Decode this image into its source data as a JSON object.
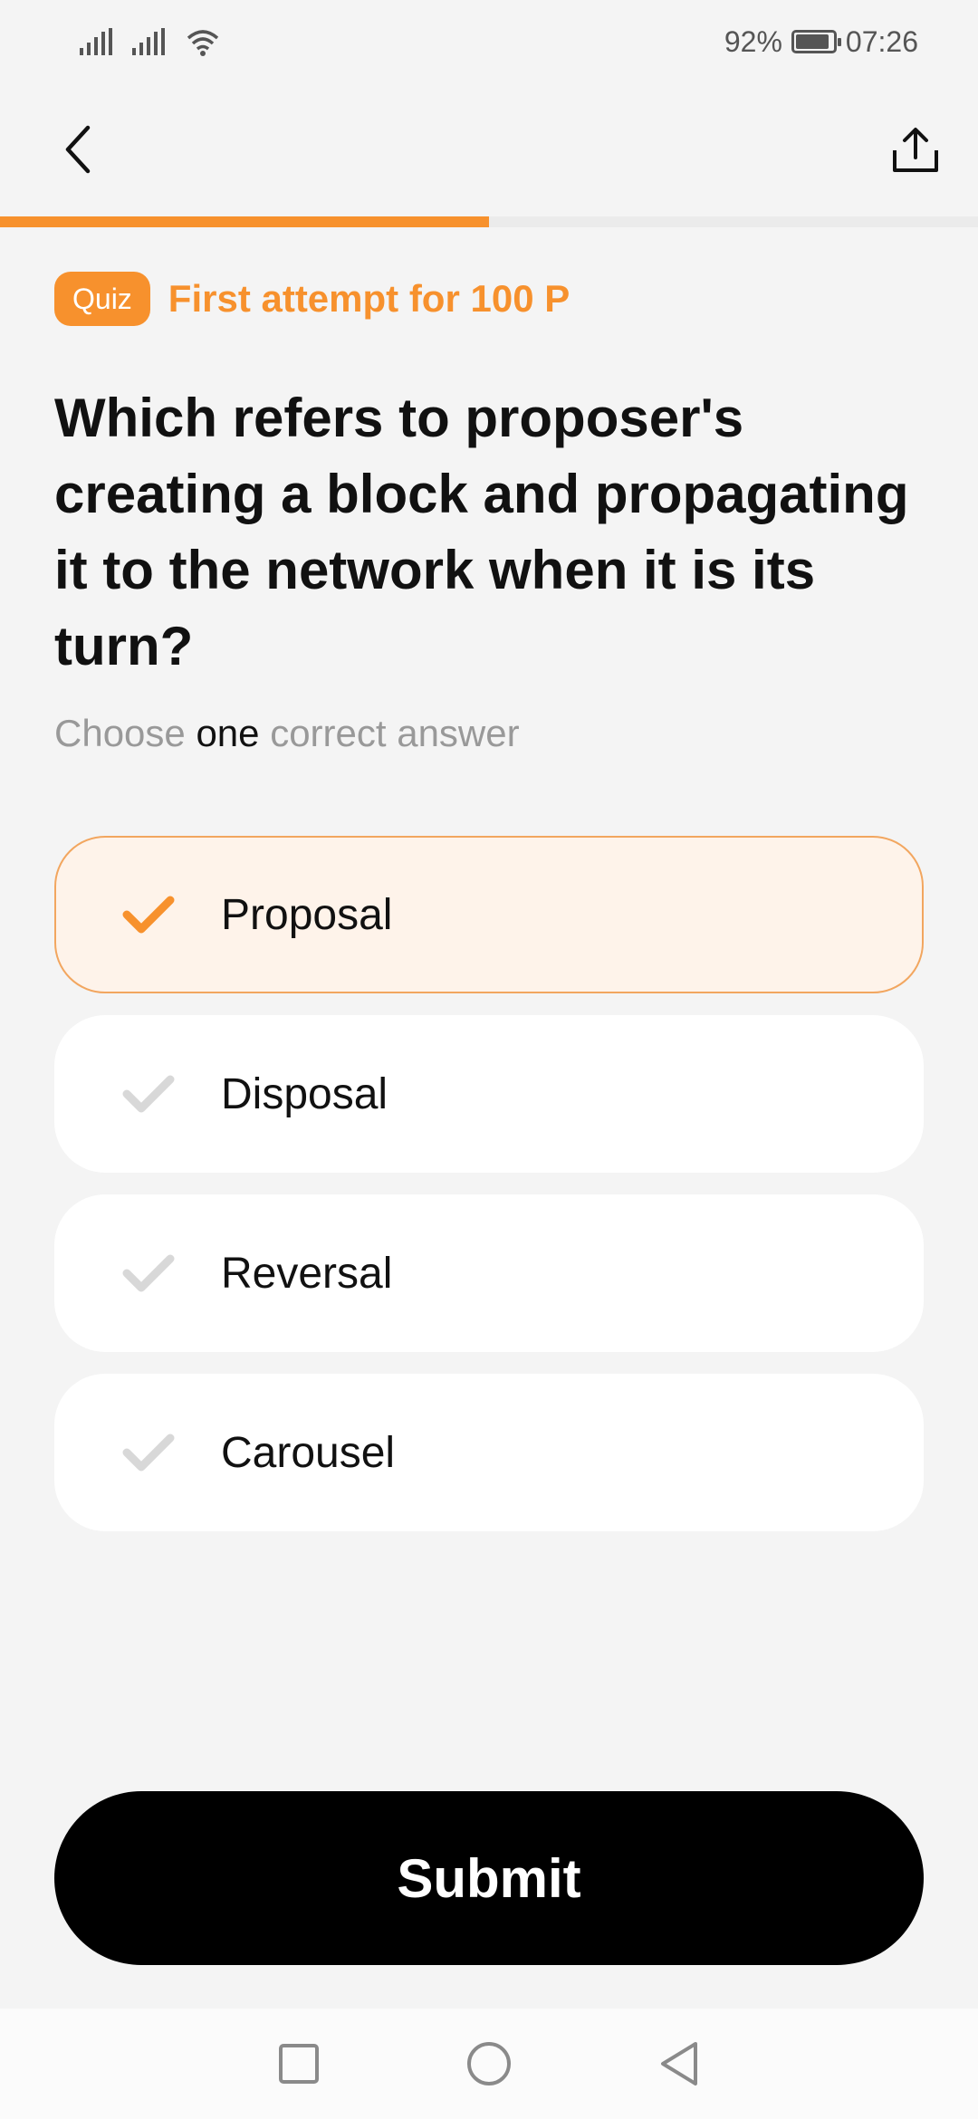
{
  "status_bar": {
    "battery_percent_text": "92%",
    "battery_level": 0.92,
    "time": "07:26",
    "icons": [
      "signal-icon",
      "signal-icon",
      "wifi-icon",
      "battery-icon"
    ]
  },
  "header": {
    "back_icon": "chevron-left-icon",
    "share_icon": "share-icon"
  },
  "progress": {
    "fraction": 0.5,
    "color": "#f7912d"
  },
  "quiz": {
    "badge": "Quiz",
    "reward_text": "First attempt for 100 P",
    "question": "Which refers to proposer's creating a block and propagating it to the network when it is its turn?",
    "instruction_prefix": "Choose",
    "instruction_emphasis": "one",
    "instruction_suffix": "correct answer"
  },
  "options": [
    {
      "label": "Proposal",
      "selected": true
    },
    {
      "label": "Disposal",
      "selected": false
    },
    {
      "label": "Reversal",
      "selected": false
    },
    {
      "label": "Carousel",
      "selected": false
    }
  ],
  "submit": {
    "label": "Submit"
  },
  "nav_bar": {
    "icons": [
      "recent-apps-icon",
      "home-icon",
      "back-icon"
    ]
  },
  "colors": {
    "accent": "#f7912d",
    "selected_bg": "#fef3ea",
    "check_inactive": "#d8d8d8"
  }
}
